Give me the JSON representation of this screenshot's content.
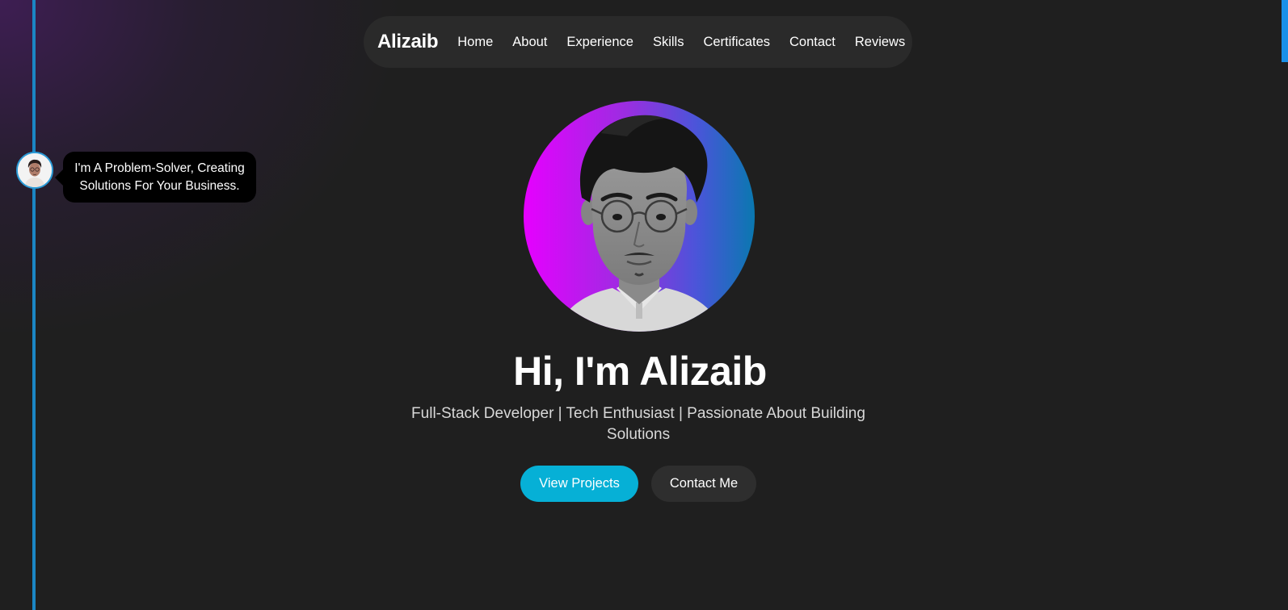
{
  "nav": {
    "brand": "Alizaib",
    "links": [
      {
        "label": "Home"
      },
      {
        "label": "About"
      },
      {
        "label": "Experience"
      },
      {
        "label": "Skills"
      },
      {
        "label": "Certificates"
      },
      {
        "label": "Contact"
      },
      {
        "label": "Reviews"
      }
    ]
  },
  "timeline": {
    "bubble_text": "I'm A Problem-Solver, Creating Solutions For Your Business."
  },
  "hero": {
    "title": "Hi, I'm Alizaib",
    "subtitle": "Full-Stack Developer | Tech Enthusiast | Passionate About Building Solutions",
    "primary_button": "View Projects",
    "secondary_button": "Contact Me"
  },
  "colors": {
    "background": "#1f1f1f",
    "navbar": "#2a2a2a",
    "accent_cyan": "#06b0d6",
    "timeline_blue": "#1b86c4",
    "gradient_start": "#e600ff",
    "gradient_end": "#0a78b0"
  },
  "icons": {
    "timeline_avatar": "profile-avatar-icon",
    "hero_photo": "profile-portrait"
  }
}
